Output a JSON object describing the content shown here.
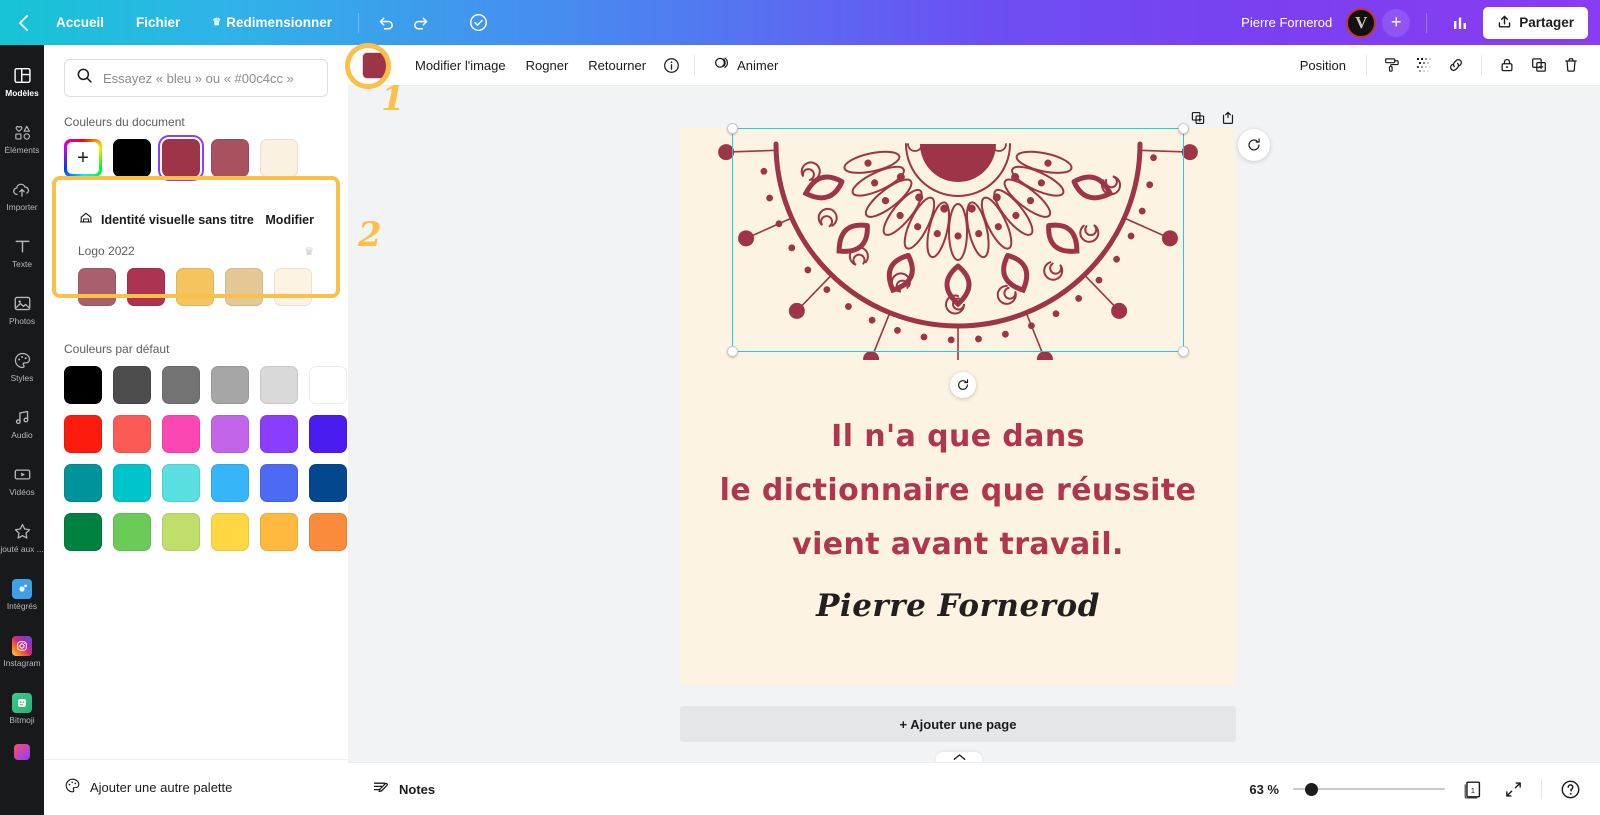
{
  "topbar": {
    "back_icon": "chevron-left-icon",
    "home": "Accueil",
    "file": "Fichier",
    "resize": "Redimensionner",
    "resize_icon": "crown-icon",
    "undo_icon": "undo-icon",
    "redo_icon": "redo-icon",
    "cloud_icon": "cloud-check-icon",
    "user": "Pierre Fornerod",
    "avatar_initial": "V",
    "plus_label": "+",
    "stats_icon": "bar-chart-icon",
    "share": "Partager",
    "share_icon": "upload-icon"
  },
  "rail": {
    "items": [
      {
        "label": "Modèles",
        "icon": "templates-icon",
        "active": true
      },
      {
        "label": "Éléments",
        "icon": "elements-icon",
        "active": false
      },
      {
        "label": "Importer",
        "icon": "upload-cloud-icon",
        "active": false
      },
      {
        "label": "Texte",
        "icon": "text-icon",
        "active": false
      },
      {
        "label": "Photos",
        "icon": "photos-icon",
        "active": false
      },
      {
        "label": "Styles",
        "icon": "styles-palette-icon",
        "active": false
      },
      {
        "label": "Audio",
        "icon": "audio-icon",
        "active": false
      },
      {
        "label": "Vidéos",
        "icon": "video-icon",
        "active": false
      },
      {
        "label": "jouté aux ...",
        "icon": "star-icon",
        "active": false
      },
      {
        "label": "Intégrés",
        "icon": "apps-icon",
        "active": false
      },
      {
        "label": "Instagram",
        "icon": "instagram-icon",
        "active": false
      },
      {
        "label": "Bitmoji",
        "icon": "bitmoji-icon",
        "active": false
      }
    ]
  },
  "panel": {
    "search": {
      "placeholder": "Essayez « bleu » ou « #00c4cc »",
      "value": "",
      "icon": "search-icon"
    },
    "document_colors": {
      "title": "Couleurs du document",
      "add_label": "+",
      "swatches": [
        {
          "name": "custom-color",
          "hex": "rainbow",
          "selected": false
        },
        {
          "name": "black",
          "hex": "#000000",
          "selected": false
        },
        {
          "name": "dark-red",
          "hex": "#9d3447",
          "selected": true
        },
        {
          "name": "mauve-red",
          "hex": "#a8515f",
          "selected": false
        },
        {
          "name": "cream",
          "hex": "#fbf1e0",
          "selected": false
        }
      ]
    },
    "brand_kit": {
      "icon": "brand-kit-icon",
      "name": "Identité visuelle sans titre",
      "edit_label": "Modifier",
      "palette_name": "Logo 2022",
      "palette_crown_icon": "crown-icon",
      "swatches": [
        "#a8616c",
        "#ac3450",
        "#f6c45e",
        "#e5c795",
        "#fdf3e3"
      ]
    },
    "default_colors": {
      "title": "Couleurs par défaut",
      "rows": [
        [
          "#000000",
          "#4d4d4d",
          "#737373",
          "#a6a6a6",
          "#d9d9d9",
          "#ffffff"
        ],
        [
          "#fc1b0d",
          "#fc5b55",
          "#fb47b4",
          "#c265e8",
          "#8b3dff",
          "#4a1cf0"
        ],
        [
          "#00939b",
          "#00c4cc",
          "#59dfe1",
          "#36b5f9",
          "#4d6af5",
          "#03488f"
        ],
        [
          "#018140",
          "#6bcb58",
          "#c0de6b",
          "#ffd742",
          "#ffb93e",
          "#fa8a3c"
        ]
      ]
    },
    "footer": {
      "label": "Ajouter une autre palette",
      "icon": "palette-icon"
    }
  },
  "editor_toolbar": {
    "color_swatch": "#9d3447",
    "edit_image": "Modifier l'image",
    "crop": "Rogner",
    "flip": "Retourner",
    "info_icon": "info-icon",
    "animate": "Animer",
    "animate_icon": "animate-icon",
    "position": "Position",
    "icons": [
      {
        "name": "paint-roller-icon"
      },
      {
        "name": "transparency-icon"
      },
      {
        "name": "link-icon"
      },
      {
        "name": "lock-icon"
      },
      {
        "name": "duplicate-icon"
      },
      {
        "name": "trash-icon"
      }
    ]
  },
  "canvas": {
    "background": "#fdf3e3",
    "artwork": {
      "name": "mandala-ornament",
      "color": "#9d3447"
    },
    "quote_lines": [
      "Il n'a que dans",
      "le dictionnaire que réussite",
      "vient avant travail."
    ],
    "quote_color": "#b0364f",
    "signature": "Pierre Fornerod",
    "signature_color": "#231f20",
    "selection_color": "#1fcfe0",
    "rotate_icon": "rotate-icon",
    "duplicate_icon": "duplicate-icon",
    "add_page_icon": "add-page-icon",
    "side_rotate_icon": "rotate-circle-icon",
    "add_page": "+ Ajouter une page",
    "collapse_icon": "chevron-up-icon"
  },
  "bottombar": {
    "notes": "Notes",
    "notes_icon": "notes-icon",
    "zoom": "63 %",
    "page_number": "1",
    "page_icon": "pages-icon",
    "fullscreen_icon": "expand-icon",
    "help_icon": "help-icon"
  },
  "annotations": [
    {
      "number": "1",
      "target": "toolbar-color-swatch"
    },
    {
      "number": "2",
      "target": "brand-kit-card"
    }
  ]
}
